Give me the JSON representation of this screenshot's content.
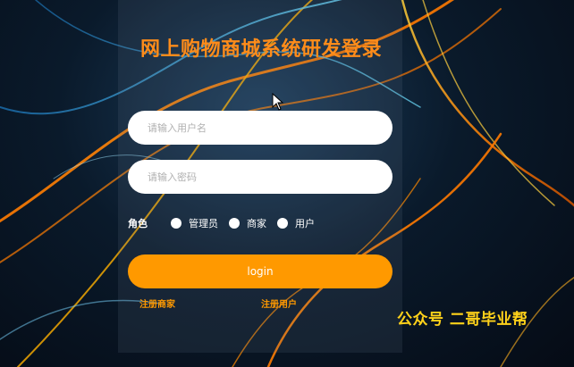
{
  "page": {
    "title": "网上购物商城系统研发登录"
  },
  "form": {
    "username_placeholder": "请输入用户名",
    "password_placeholder": "请输入密码",
    "role_label": "角色",
    "roles": [
      {
        "label": "管理员",
        "selected": false
      },
      {
        "label": "商家",
        "selected": false
      },
      {
        "label": "用户",
        "selected": false
      }
    ],
    "login_label": "login"
  },
  "links": {
    "register_merchant": "注册商家",
    "register_user": "注册用户"
  },
  "watermark": "公众号 二哥毕业帮",
  "colors": {
    "accent": "#ff9900",
    "title": "#ff8c1a",
    "watermark": "#ffd21a"
  }
}
